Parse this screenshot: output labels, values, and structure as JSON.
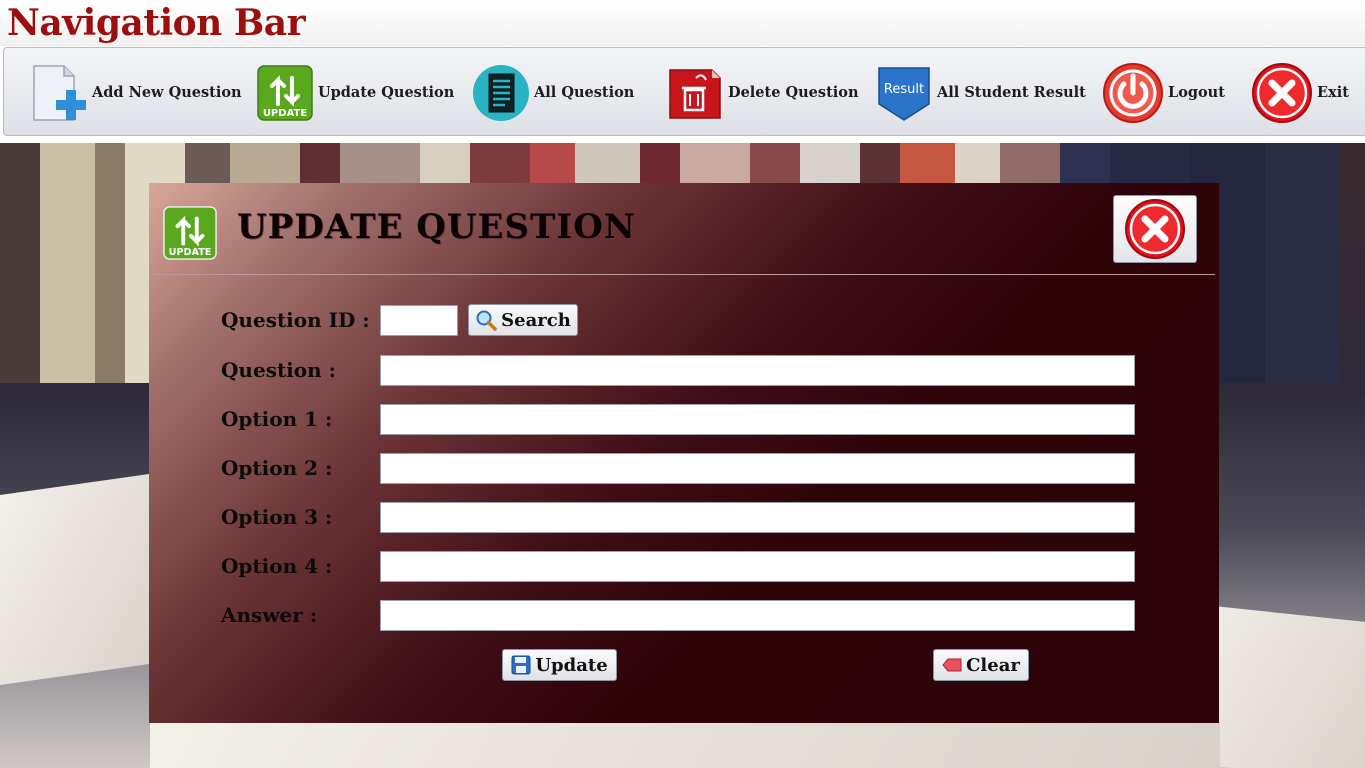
{
  "app": {
    "title": "Navigation Bar"
  },
  "toolbar": {
    "items": [
      {
        "label": "Add New Question",
        "icon": "add-document-icon"
      },
      {
        "label": "Update Question",
        "icon": "update-icon"
      },
      {
        "label": "All Question",
        "icon": "document-list-icon"
      },
      {
        "label": "Delete Question",
        "icon": "trash-icon"
      },
      {
        "label": "All Student Result",
        "icon": "result-badge-icon"
      },
      {
        "label": "Logout",
        "icon": "power-icon"
      },
      {
        "label": "Exit",
        "icon": "close-icon"
      }
    ],
    "result_badge_text": "Result",
    "update_icon_text": "UPDATE"
  },
  "dialog": {
    "title": "UPDATE QUESTION",
    "icon_text": "UPDATE",
    "fields": {
      "question_id_label": "Question ID :",
      "question_label": "Question :",
      "option1_label": "Option 1 :",
      "option2_label": "Option 2 :",
      "option3_label": "Option 3 :",
      "option4_label": "Option 4 :",
      "answer_label": "Answer :"
    },
    "values": {
      "question_id": "",
      "question": "",
      "option1": "",
      "option2": "",
      "option3": "",
      "option4": "",
      "answer": ""
    },
    "buttons": {
      "search": "Search",
      "update": "Update",
      "clear": "Clear"
    }
  },
  "colors": {
    "title_red": "#9b0f0f",
    "dialog_dark": "#2c030a",
    "dialog_light": "#d8a79a",
    "exit_red": "#e3111b"
  }
}
